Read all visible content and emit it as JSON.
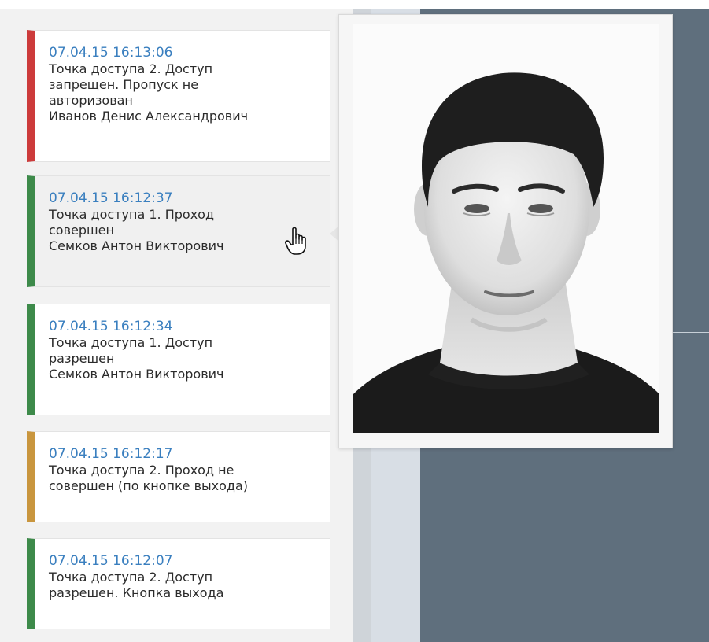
{
  "events": [
    {
      "time": "07.04.15 16:13:06",
      "lines": [
        "Точка доступа 2. Доступ",
        "запрещен. Пропуск не",
        "авторизован",
        "Иванов Денис Александрович"
      ],
      "status_color": "#cc3b3b"
    },
    {
      "time": "07.04.15 16:12:37",
      "lines": [
        "Точка доступа 1. Проход",
        "совершен",
        "Семков Антон Викторович"
      ],
      "status_color": "#3d8a4a"
    },
    {
      "time": "07.04.15 16:12:34",
      "lines": [
        "Точка доступа 1. Доступ",
        "разрешен",
        "Семков Антон Викторович"
      ],
      "status_color": "#3d8a4a"
    },
    {
      "time": "07.04.15 16:12:17",
      "lines": [
        "Точка доступа 2. Проход не",
        "совершен (по кнопке выхода)"
      ],
      "status_color": "#c9963e"
    },
    {
      "time": "07.04.15 16:12:07",
      "lines": [
        "Точка доступа 2. Доступ",
        "разрешен. Кнопка выхода"
      ],
      "status_color": "#3d8a4a"
    }
  ],
  "popup": {
    "content": "person-photo"
  },
  "cursor": {
    "icon": "hand-pointer-icon"
  },
  "colors": {
    "time_text": "#3a7fbf",
    "body_text": "#2b2b2b",
    "dark_background": "#5f6f7d",
    "panel_background": "#f2f2f2"
  }
}
